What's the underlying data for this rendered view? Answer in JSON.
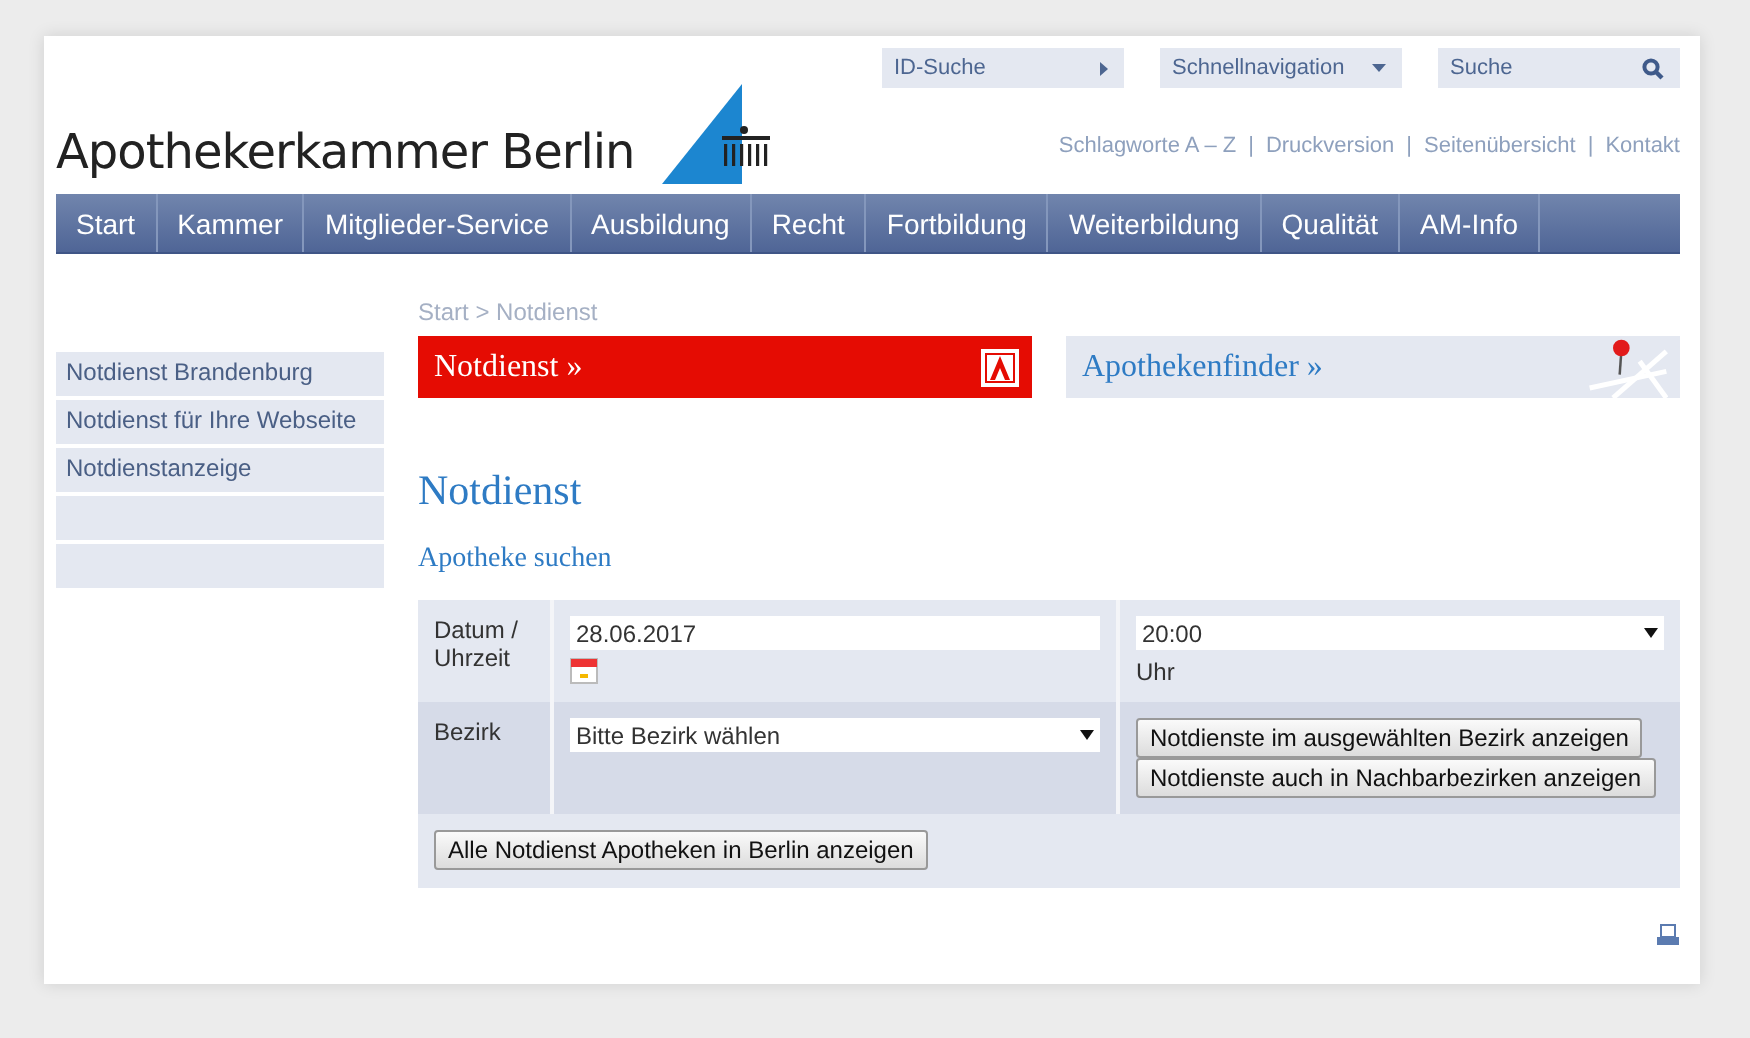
{
  "logo": {
    "text": "Apothekerkammer Berlin"
  },
  "tools": [
    {
      "kind": "link",
      "label": "ID-Suche"
    },
    {
      "kind": "select",
      "label": "Schnellnavigation"
    },
    {
      "kind": "search",
      "placeholder": "Suche"
    }
  ],
  "service_links": [
    "Schlagworte A – Z",
    "Druckversion",
    "Seitenübersicht",
    "Kontakt"
  ],
  "service_link_separator": "|",
  "nav": [
    "Start",
    "Kammer",
    "Mitglieder-Service",
    "Ausbildung",
    "Recht",
    "Fortbildung",
    "Weiterbildung",
    "Qualität",
    "AM-Info"
  ],
  "sidebar": {
    "items": [
      {
        "kind": "link",
        "label": "Notdienst Brandenburg"
      },
      {
        "kind": "link",
        "label": "Notdienst für Ihre Webseite"
      },
      {
        "kind": "link",
        "label": "Notdienstanzeige"
      },
      {
        "kind": "blank"
      },
      {
        "kind": "blank"
      }
    ]
  },
  "breadcrumb": [
    "Start",
    "Notdienst"
  ],
  "breadcrumb_separator": ">",
  "teasers": [
    {
      "kind": "notdienst",
      "label": "Notdienst »"
    },
    {
      "kind": "finder",
      "label": "Apothekenfinder »"
    }
  ],
  "heading": "Notdienst",
  "subheading": "Apotheke suchen",
  "form": {
    "date_label": "Datum / Uhrzeit",
    "date": "28.06.2017",
    "time": "20:00",
    "time_unit": "Uhr",
    "district_label": "Bezirk",
    "district": "Bitte Bezirk wählen",
    "buttons": [
      "Notdienste im ausgewählten Bezirk anzeigen",
      "Notdienste auch in Nachbarbezirken anzeigen"
    ],
    "all_button": "Alle Notdienst Apotheken in Berlin anzeigen"
  }
}
